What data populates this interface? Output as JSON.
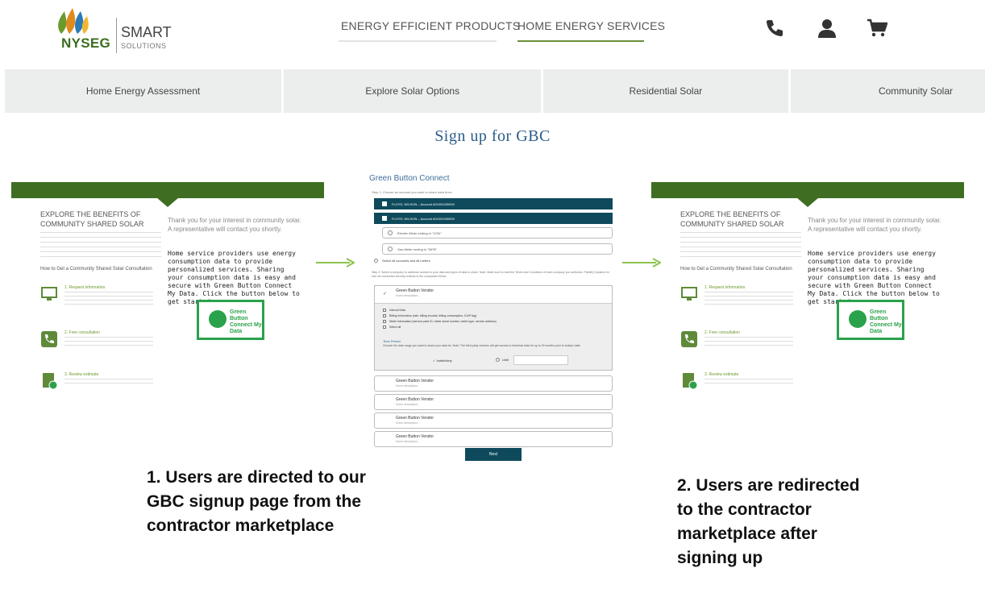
{
  "header": {
    "logo": {
      "brand": "NYSEG",
      "product": "SMART",
      "sub": "SOLUTIONS"
    },
    "nav": [
      "ENERGY EFFICIENT PRODUCTS",
      "HOME ENERGY SERVICES"
    ],
    "icons": [
      "phone-icon",
      "user-icon",
      "cart-icon"
    ]
  },
  "subnav": {
    "items": [
      "Home Energy Assessment",
      "Explore Solar Options",
      "Residential Solar",
      "Community Solar"
    ]
  },
  "title": "Sign up for GBC",
  "contractor": {
    "explore": "EXPLORE THE BENEFITS OF COMMUNITY SHARED SOLAR",
    "howto": "How to Get a Community Shared Solar Consultation",
    "steps": [
      "1. Request information",
      "2. Free consultation",
      "3. Review estimate"
    ],
    "thanks": "Thank you for your interest in community solar. A representative will contact you shortly.",
    "providers": "Home service providers use energy consumption data to provide personalized services. Sharing your consumption data is easy and secure with Green Button Connect My Data. Click the button below to get started.",
    "button": "Green Button Connect My Data"
  },
  "form": {
    "title": "Green Button Connect",
    "step1": "Step 1: Choose an account you want to share data from:",
    "accounts": [
      "FLOYD, WILSON – Account #01001000000",
      "FLOYD, WILSON – Account #01001000000"
    ],
    "meters": [
      "Electric Meter ending in \"1234\"",
      "Gas Meter ending in \"5678\""
    ],
    "select_all": "Select all accounts and all meters",
    "step2": "Step 2: Select a company to authorize access to your data and types of data to share. Note: Make sure to read the Terms and Conditions of each company you authorize. PlanitIQ explains for has not conducted security reviews to the companies below.",
    "vendor": "Green Button Vendor",
    "vendor_desc": "Some description...",
    "perms": [
      "Interval Data",
      "Billing Information (rate, billing bounds, billing consumption, ICAP tag)",
      "Meter Information (service point ID, meter serial number, meter type, service address)",
      "Select all"
    ],
    "time_period": "Time Period:",
    "time_desc": "Choose the date range you want to share your data for. Note: The third party vendors will get access to historical data for up to 24 months prior to today's date.",
    "indefinitely": "✓ Indefinitely",
    "until": "Until",
    "next": "Next"
  },
  "captions": {
    "c1": "1. Users are directed to our GBC signup page from the contractor marketplace",
    "c2": "2. Users are redirected to the contractor marketplace after signing up"
  },
  "colors": {
    "green": "#3f6e22",
    "teal": "#0e4a5c",
    "gbc_green": "#2aa24b",
    "title_blue": "#2b5d8a"
  }
}
